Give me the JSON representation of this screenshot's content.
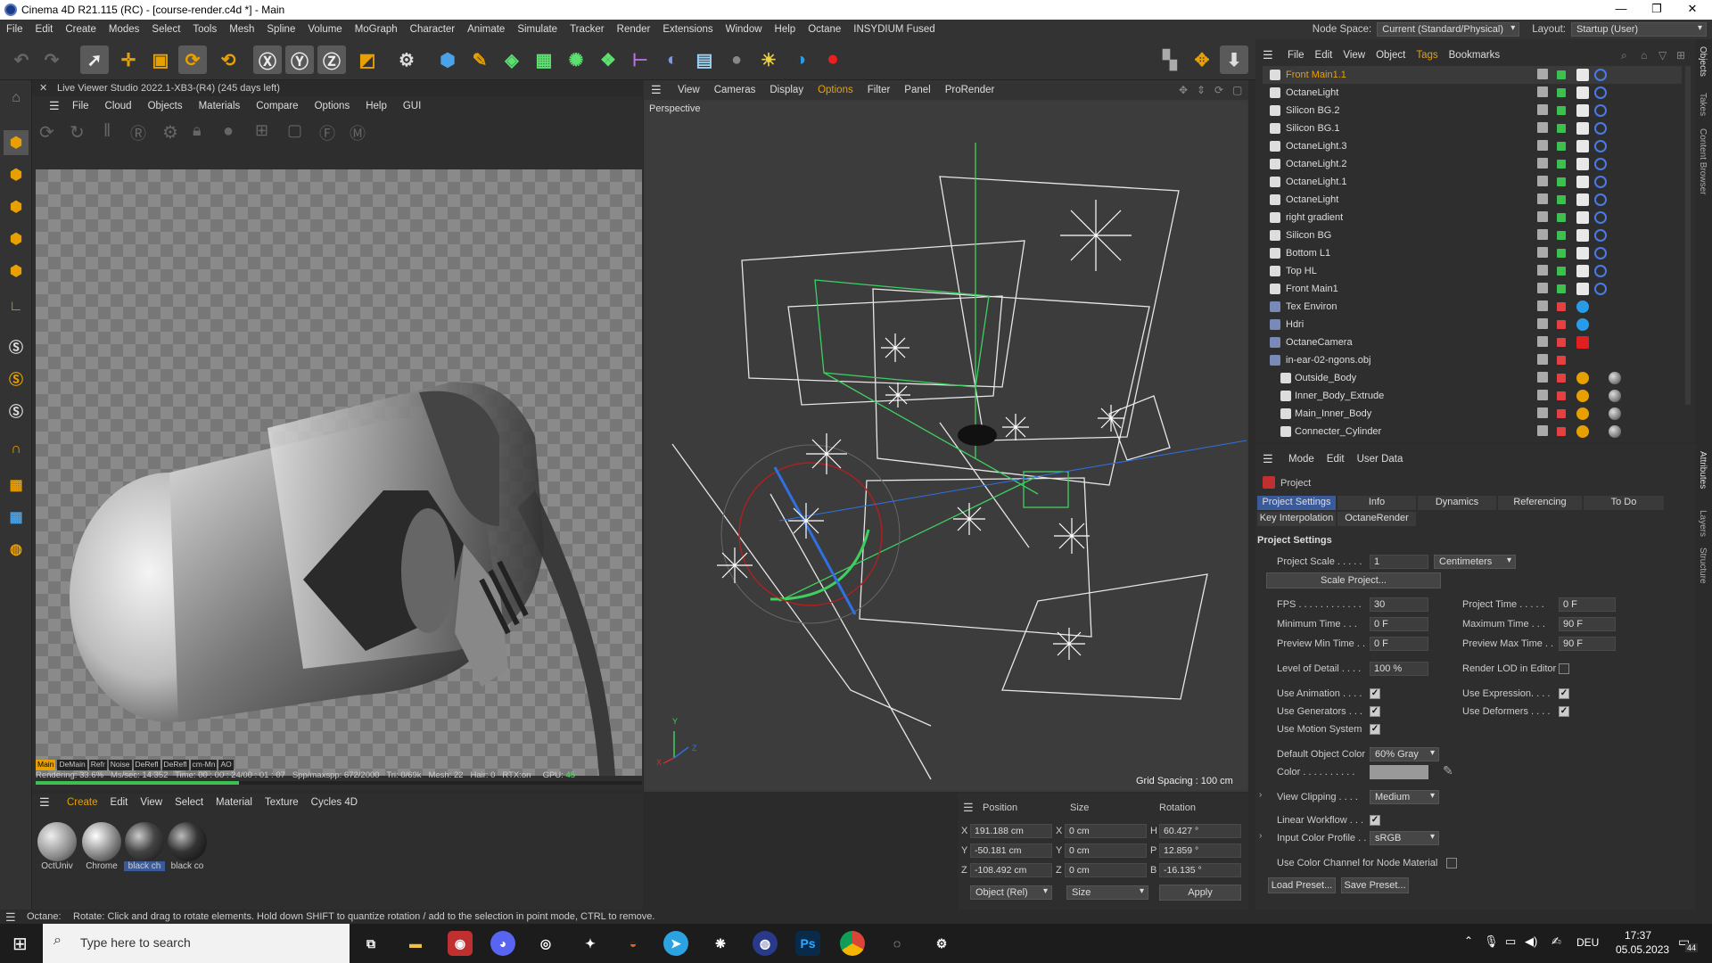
{
  "window": {
    "title": "Cinema 4D R21.115 (RC) - [course-render.c4d *] - Main"
  },
  "menubar": {
    "items": [
      "File",
      "Edit",
      "Create",
      "Modes",
      "Select",
      "Tools",
      "Mesh",
      "Spline",
      "Volume",
      "MoGraph",
      "Character",
      "Animate",
      "Simulate",
      "Tracker",
      "Render",
      "Extensions",
      "Window",
      "Help",
      "Octane",
      "INSYDIUM Fused"
    ],
    "node_space_label": "Node Space:",
    "node_space_value": "Current (Standard/Physical)",
    "layout_label": "Layout:",
    "layout_value": "Startup (User)"
  },
  "live_viewer": {
    "title": "Live Viewer Studio 2022.1-XB3-(R4) (245 days left)",
    "menu": [
      "File",
      "Cloud",
      "Objects",
      "Materials",
      "Compare",
      "Options",
      "Help",
      "GUI"
    ],
    "channels": [
      "Main",
      "DeMain",
      "Refr",
      "Noise",
      "DeRefl",
      "DeRefl",
      "cm-Mn",
      "AO"
    ],
    "status": {
      "rendering": "Rendering: 33.6%",
      "ms": "Ms/sec: 14.352",
      "time": "Time: 00 : 00 : 24/00 : 01 : 07",
      "spp": "Spp/maxspp: 672/2000",
      "tri": "Tri: 0/69k",
      "mesh": "Mesh: 22",
      "hair": "Hair: 0",
      "rtx": "RTX:on",
      "gpu": "GPU:",
      "gpu_val": "45"
    },
    "progress": 0.336
  },
  "viewport": {
    "menu": [
      "View",
      "Cameras",
      "Display",
      "Options",
      "Filter",
      "Panel",
      "ProRender"
    ],
    "label": "Perspective",
    "grid": "Grid Spacing : 100 cm",
    "axis_x": "X",
    "axis_y": "Y",
    "axis_z": "Z"
  },
  "materials": {
    "menu": [
      "Create",
      "Edit",
      "View",
      "Select",
      "Material",
      "Texture",
      "Cycles 4D"
    ],
    "items": [
      {
        "label": "OctUniv"
      },
      {
        "label": "Chrome"
      },
      {
        "label": "black ch"
      },
      {
        "label": "black co"
      }
    ]
  },
  "coords": {
    "headers": [
      "Position",
      "Size",
      "Rotation"
    ],
    "rows": [
      {
        "axis": "X",
        "pos": "191.188 cm",
        "saxis": "X",
        "size": "0 cm",
        "raxis": "H",
        "rot": "60.427 °"
      },
      {
        "axis": "Y",
        "pos": "-50.181 cm",
        "saxis": "Y",
        "size": "0 cm",
        "raxis": "P",
        "rot": "12.859 °"
      },
      {
        "axis": "Z",
        "pos": "-108.492 cm",
        "saxis": "Z",
        "size": "0 cm",
        "raxis": "B",
        "rot": "-16.135 °"
      }
    ],
    "mode": "Object (Rel)",
    "size_mode": "Size",
    "apply": "Apply"
  },
  "objects": {
    "menu": [
      "File",
      "Edit",
      "View",
      "Object",
      "Tags",
      "Bookmarks"
    ],
    "items": [
      {
        "name": "Front Main1.1",
        "color": "#e8a000"
      },
      {
        "name": "OctaneLight",
        "color": "#ddd"
      },
      {
        "name": "Silicon BG.2",
        "color": "#ddd"
      },
      {
        "name": "Silicon BG.1",
        "color": "#ddd"
      },
      {
        "name": "OctaneLight.3",
        "color": "#ddd"
      },
      {
        "name": "OctaneLight.2",
        "color": "#ddd"
      },
      {
        "name": "OctaneLight.1",
        "color": "#ddd"
      },
      {
        "name": "OctaneLight",
        "color": "#ddd"
      },
      {
        "name": "right gradient",
        "color": "#ddd"
      },
      {
        "name": "Silicon BG",
        "color": "#ddd"
      },
      {
        "name": "Bottom L1",
        "color": "#ddd"
      },
      {
        "name": "Top HL",
        "color": "#ddd"
      },
      {
        "name": "Front Main1",
        "color": "#ddd"
      },
      {
        "name": "Tex Environ",
        "color": "#ddd"
      },
      {
        "name": "Hdri",
        "color": "#ddd"
      },
      {
        "name": "OctaneCamera",
        "color": "#ddd"
      },
      {
        "name": "in-ear-02-ngons.obj",
        "color": "#ddd"
      },
      {
        "name": "Outside_Body",
        "color": "#ddd"
      },
      {
        "name": "Inner_Body_Extrude",
        "color": "#ddd"
      },
      {
        "name": "Main_Inner_Body",
        "color": "#ddd"
      },
      {
        "name": "Connecter_Cylinder",
        "color": "#ddd"
      }
    ]
  },
  "attributes": {
    "menu": [
      "Mode",
      "Edit",
      "User Data"
    ],
    "project": "Project",
    "tabs": [
      "Project Settings",
      "Info",
      "Dynamics",
      "Referencing",
      "To Do"
    ],
    "subtabs": [
      "Key Interpolation",
      "OctaneRender"
    ],
    "section": "Project Settings",
    "project_scale_label": "Project Scale . . . . .",
    "project_scale": "1",
    "unit": "Centimeters",
    "scale_btn": "Scale Project...",
    "fps_label": "FPS . . . . . . . . . . . .",
    "fps": "30",
    "project_time_label": "Project Time . . . . .",
    "project_time": "0 F",
    "min_time_label": "Minimum Time . . .",
    "min_time": "0 F",
    "max_time_label": "Maximum Time . . .",
    "max_time": "90 F",
    "prev_min_label": "Preview Min Time . .",
    "prev_min": "0 F",
    "prev_max_label": "Preview Max Time . .",
    "prev_max": "90 F",
    "lod_label": "Level of Detail . . . .",
    "lod": "100 %",
    "render_lod_label": "Render LOD in Editor",
    "use_anim": "Use Animation . . . .",
    "use_expr": "Use Expression. . . .",
    "use_gen": "Use Generators . . .",
    "use_def": "Use Deformers . . . .",
    "use_motion": "Use Motion System",
    "def_color_label": "Default Object Color",
    "def_color": "60% Gray",
    "color_label": "Color . . . . . . . . . .",
    "view_clip_label": "View Clipping . . . .",
    "view_clip": "Medium",
    "linear_label": "Linear Workflow . . .",
    "input_profile_label": "Input Color Profile . .",
    "input_profile": "sRGB",
    "color_channel_label": "Use Color Channel for Node Material",
    "load": "Load Preset...",
    "save": "Save Preset..."
  },
  "side_tabs": [
    "Objects",
    "Takes",
    "Content Browser",
    "Attributes",
    "Layers",
    "Structure"
  ],
  "status": {
    "prefix": "Octane:",
    "text": "Rotate: Click and drag to rotate elements. Hold down SHIFT to quantize rotation / add to the selection in point mode, CTRL to remove."
  },
  "taskbar": {
    "search": "Type here to search",
    "lang": "DEU",
    "time": "17:37",
    "date": "05.05.2023",
    "notif": "44"
  }
}
